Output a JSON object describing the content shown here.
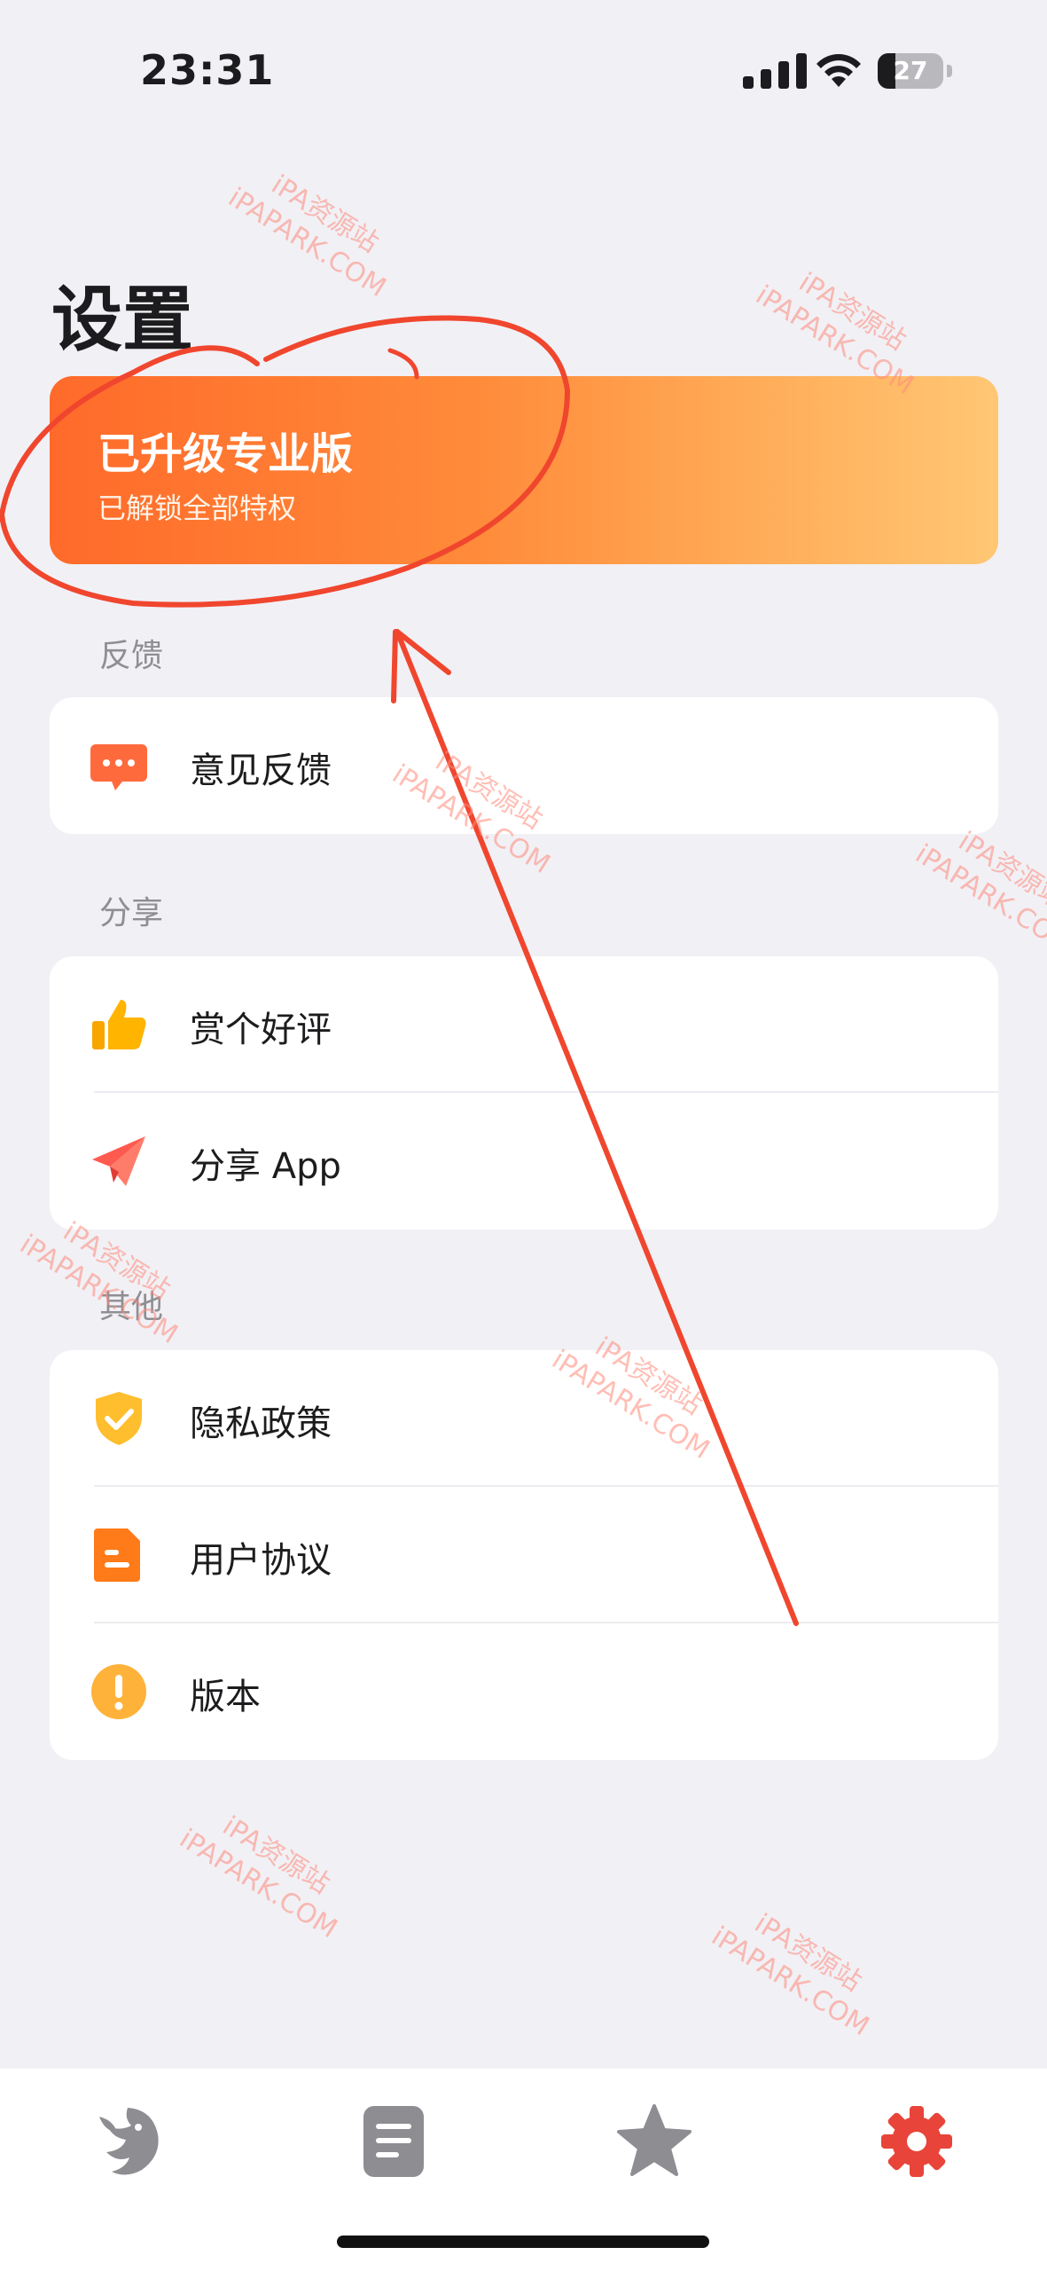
{
  "status_bar": {
    "time": "23:31",
    "battery": "27",
    "battery_level": 0.27
  },
  "page": {
    "title": "设置"
  },
  "pro_banner": {
    "title": "已升级专业版",
    "subtitle": "已解锁全部特权"
  },
  "sections": [
    {
      "header": "反馈",
      "items": [
        {
          "label": "意见反馈",
          "icon": "chat-bubble-icon"
        }
      ]
    },
    {
      "header": "分享",
      "items": [
        {
          "label": "赏个好评",
          "icon": "thumbs-up-icon"
        },
        {
          "label": "分享 App",
          "icon": "paper-plane-icon"
        }
      ]
    },
    {
      "header": "其他",
      "items": [
        {
          "label": "隐私政策",
          "icon": "shield-check-icon"
        },
        {
          "label": "用户协议",
          "icon": "document-icon"
        },
        {
          "label": "版本",
          "icon": "exclamation-circle-icon"
        }
      ]
    }
  ],
  "tab_bar": {
    "active_index": 3,
    "tabs": [
      {
        "icon": "dragon-icon"
      },
      {
        "icon": "list-document-icon"
      },
      {
        "icon": "star-icon"
      },
      {
        "icon": "gear-icon"
      }
    ]
  },
  "watermark": {
    "line1": "iPA资源站",
    "line2": "iPAPARK.COM"
  },
  "colors": {
    "accent": "#e8443a",
    "banner_start": "#ff6a2a",
    "banner_end": "#ffc774",
    "annotation": "#f0462e",
    "background": "#f1f0f5"
  }
}
